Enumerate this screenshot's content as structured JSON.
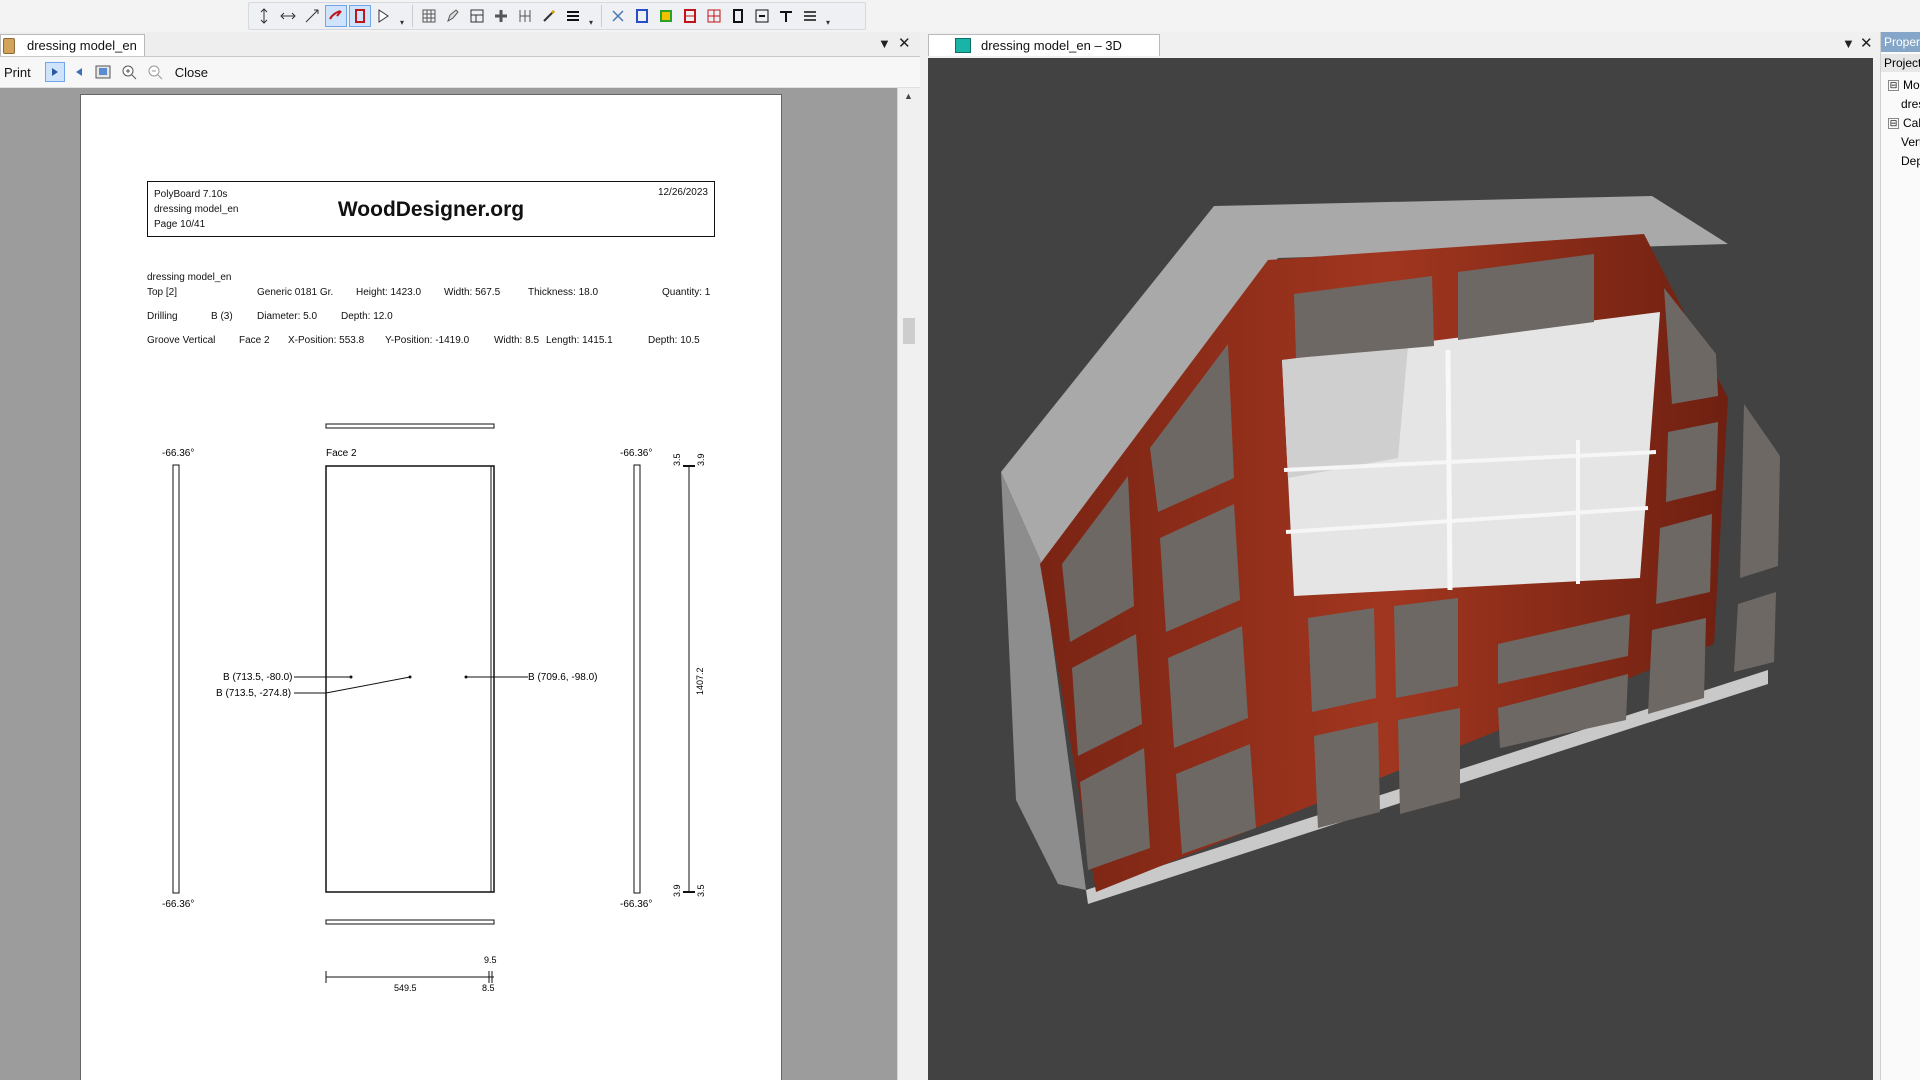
{
  "left_panel": {
    "tab_label": "dressing model_en",
    "print_bar": {
      "print_label": "Print",
      "close_label": "Close"
    }
  },
  "report": {
    "header": {
      "software": "PolyBoard 7.10s",
      "model": "dressing model_en",
      "page": "Page 10/41",
      "site": "WoodDesigner.org",
      "date": "12/26/2023"
    },
    "model_name": "dressing model_en",
    "part": {
      "name": "Top [2]",
      "material": "Generic 0181 Gr.",
      "height": "Height: 1423.0",
      "width": "Width: 567.5",
      "thickness": "Thickness: 18.0",
      "quantity": "Quantity: 1"
    },
    "drilling": {
      "label": "Drilling",
      "code": "B (3)",
      "diameter": "Diameter: 5.0",
      "depth": "Depth: 12.0"
    },
    "groove": {
      "label": "Groove Vertical",
      "face": "Face 2",
      "x": "X-Position: 553.8",
      "y": "Y-Position: -1419.0",
      "width": "Width: 8.5",
      "length": "Length: 1415.1",
      "depth": "Depth: 10.5"
    },
    "drawing": {
      "face_label": "Face 2",
      "angles": [
        "-66.36°",
        "-66.36°",
        "-66.36°",
        "-66.36°"
      ],
      "callouts": [
        "B (713.5, -80.0)",
        "B (713.5, -274.8)",
        "B (709.6, -98.0)"
      ],
      "dims": {
        "top_a": "3.5",
        "top_b": "3.9",
        "total": "1407.2",
        "bot_a": "3.9",
        "bot_b": "3.5",
        "width": "549.5",
        "groove_w": "9.5",
        "groove_d": "8.5"
      }
    }
  },
  "right_panel": {
    "tab_label": "dressing model_en – 3D"
  },
  "properties": {
    "title": "Properties",
    "subtitle": "Project",
    "rows": [
      {
        "expander": "⊟",
        "text": "Model"
      },
      {
        "expander": "",
        "text": "dressing model_en"
      },
      {
        "expander": "⊟",
        "text": "Cabinet"
      },
      {
        "expander": "",
        "text": "Vertical"
      },
      {
        "expander": "",
        "text": "Depth"
      }
    ]
  },
  "colors": {
    "background": "#424242",
    "cabinet_frame": "#8a2e1b",
    "panel": "#6e6864",
    "carcass": "#a9a9a9",
    "interior": "#e5e5e5"
  }
}
